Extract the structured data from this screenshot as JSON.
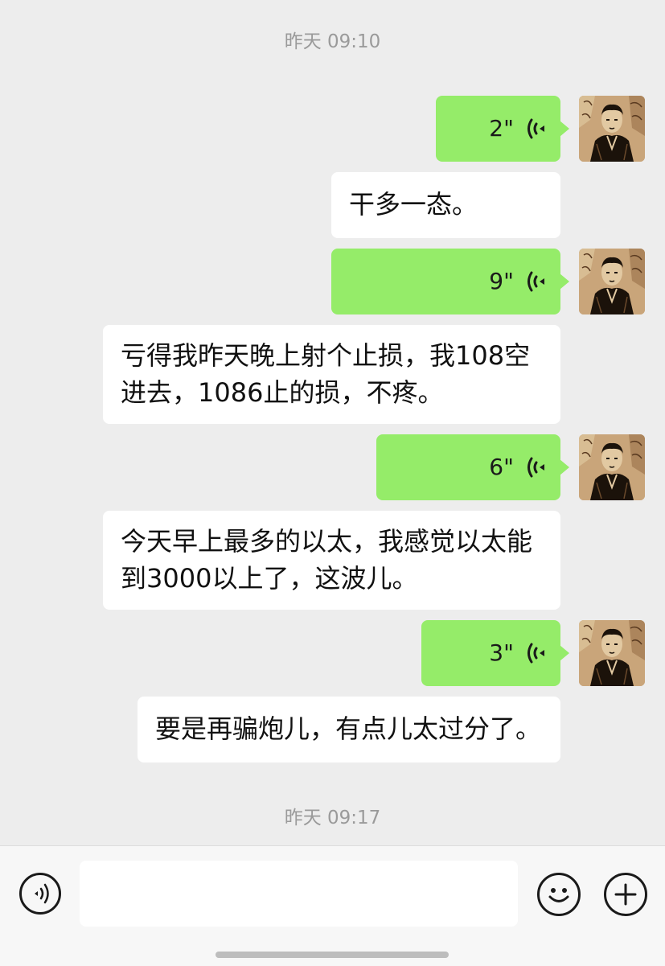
{
  "timestamps": {
    "top": "昨天 09:10",
    "bottom": "昨天 09:17"
  },
  "messages": [
    {
      "type": "voice",
      "duration": "2\""
    },
    {
      "type": "text",
      "text": "干多一态。"
    },
    {
      "type": "voice",
      "duration": "9\""
    },
    {
      "type": "text",
      "text": "亏得我昨天晚上射个止损，我108空\n进去，1086止的损，不疼。"
    },
    {
      "type": "voice",
      "duration": "6\""
    },
    {
      "type": "text",
      "text": "今天早上最多的以太，我感觉以太能\n到3000以上了，这波儿。"
    },
    {
      "type": "voice",
      "duration": "3\""
    },
    {
      "type": "text",
      "text": "要是再骗炮儿，有点儿太过分了。"
    }
  ],
  "input": {
    "value": "",
    "placeholder": ""
  },
  "icons": {
    "voice_toggle": "voice-mode-icon",
    "emoji": "emoji-icon",
    "plus": "plus-icon",
    "voice_message": "voice-wave-icon"
  },
  "colors": {
    "background": "#ededed",
    "sent_bubble": "#95ec69",
    "received_bubble": "#ffffff",
    "bottom_bar": "#f7f7f7"
  }
}
